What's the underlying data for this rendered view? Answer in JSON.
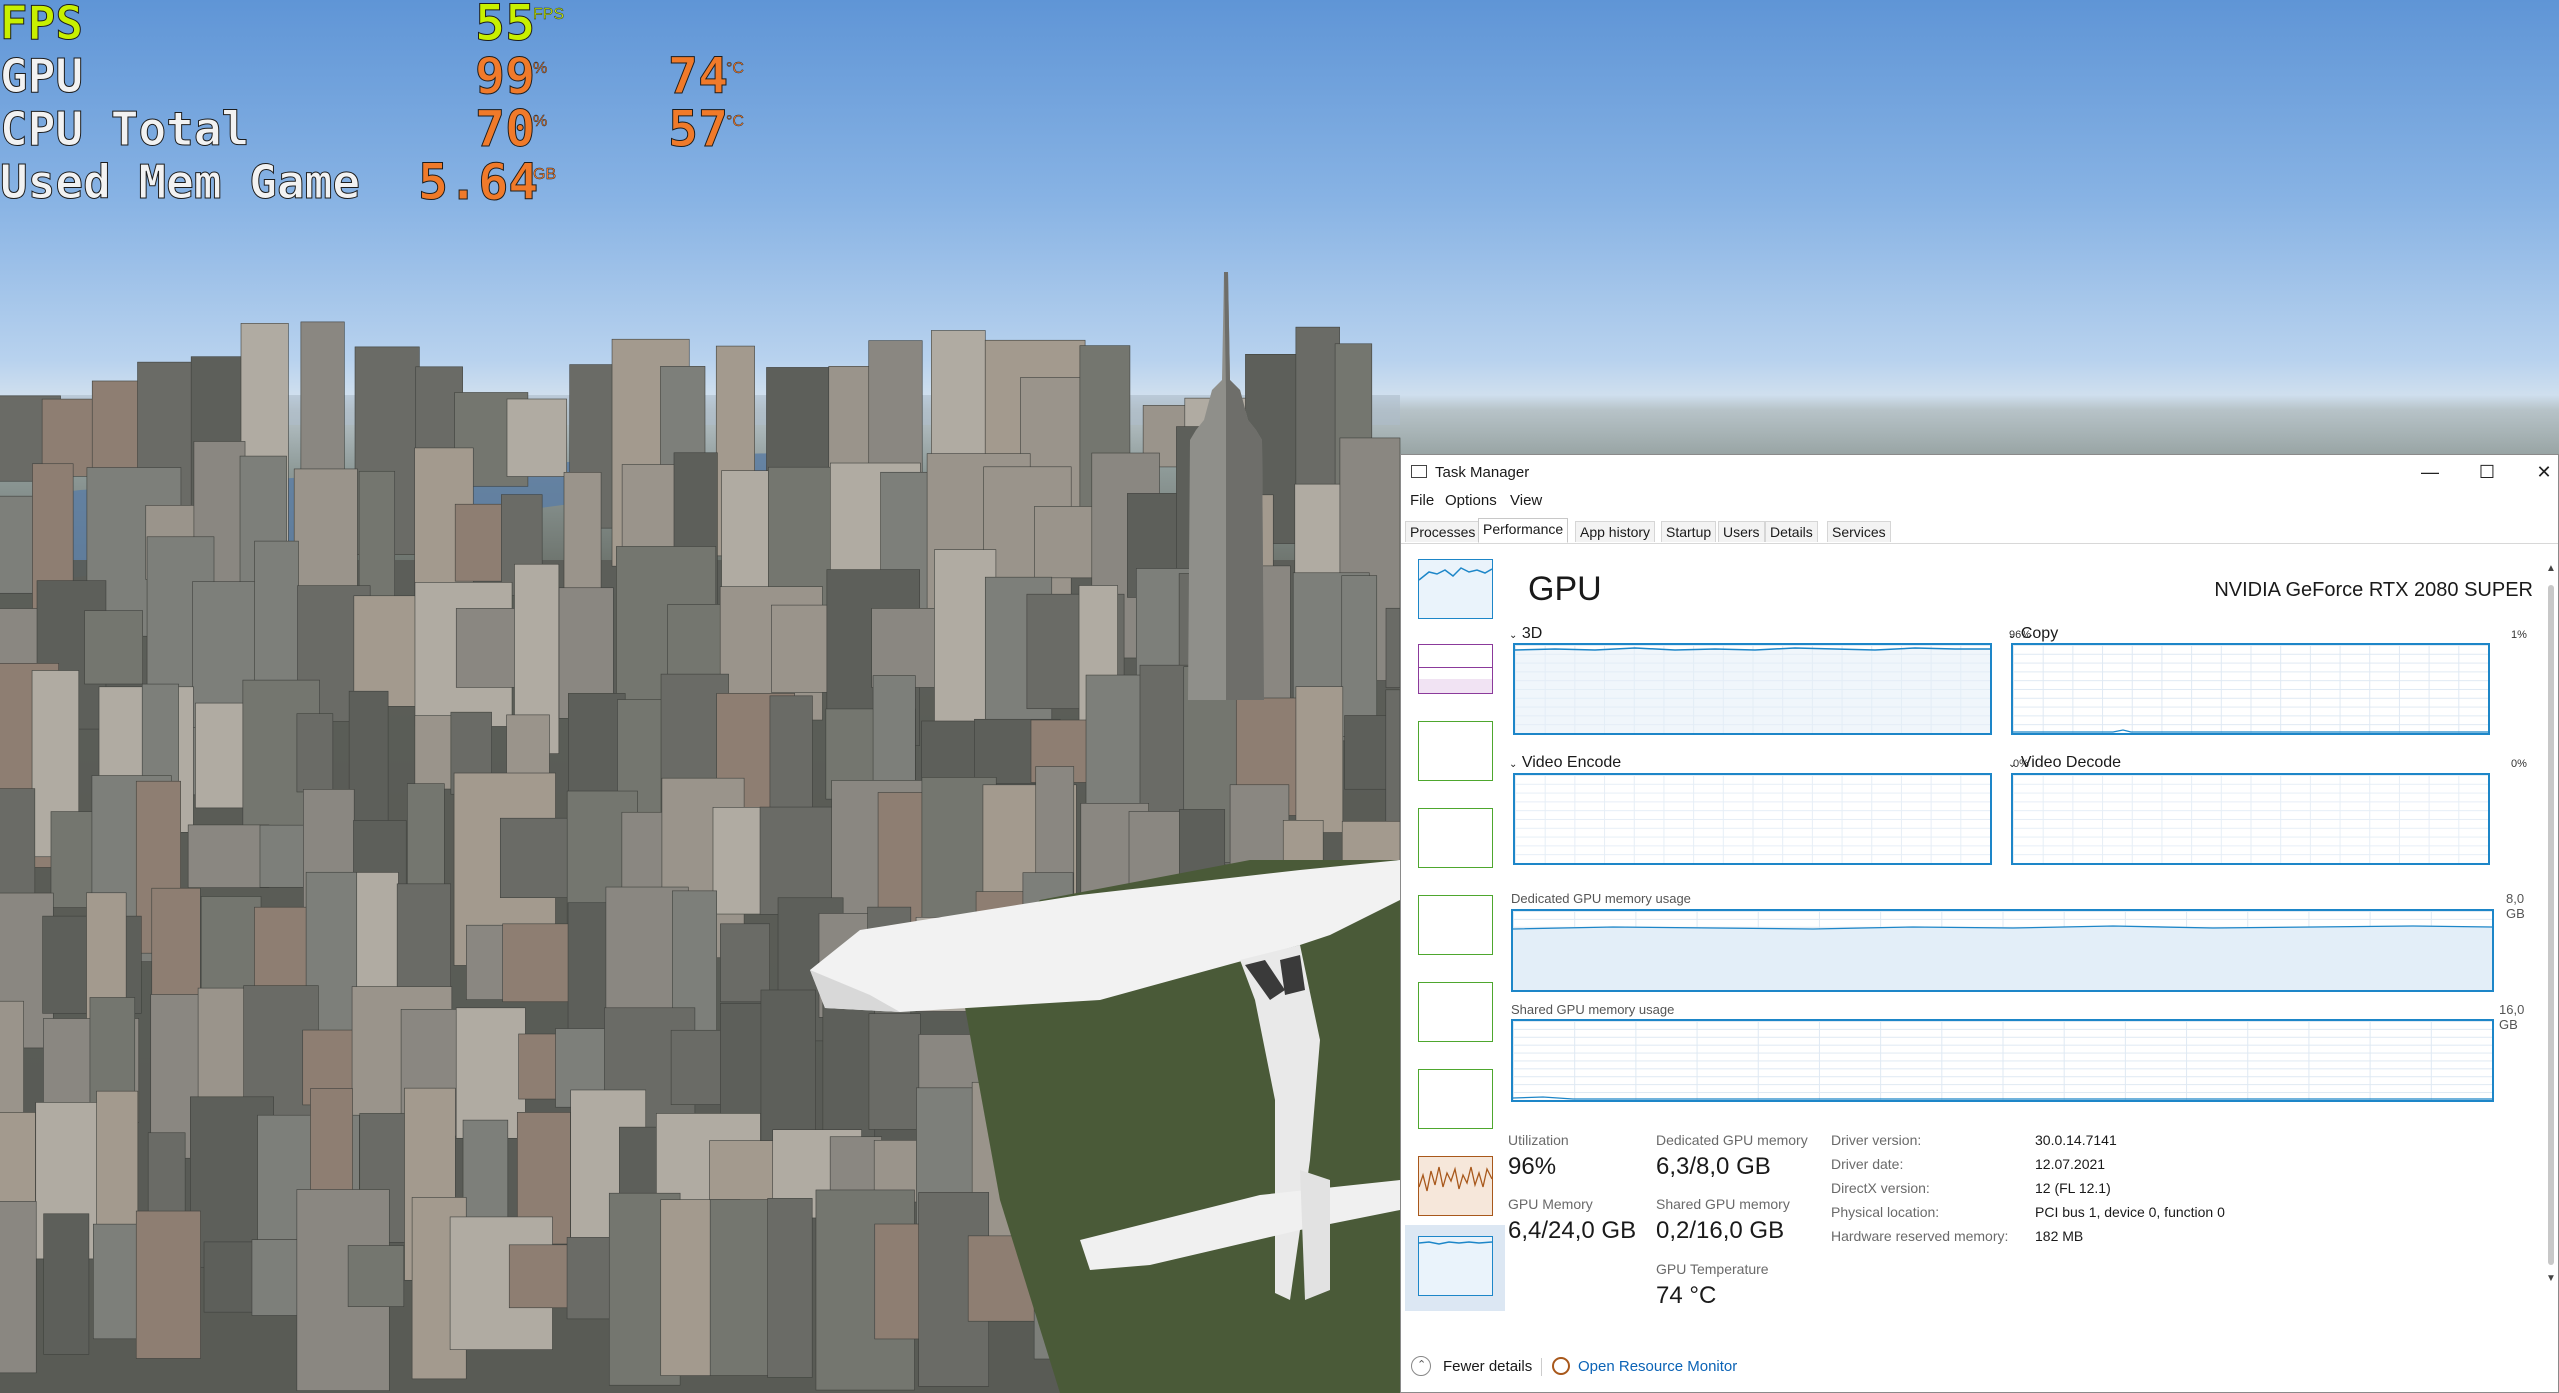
{
  "hud": {
    "fps": {
      "label": "FPS",
      "value": "55",
      "unit": "FPS"
    },
    "gpu": {
      "label": "GPU",
      "value": "99",
      "unit": "%",
      "temp": "74",
      "temp_unit": "°C"
    },
    "cpu": {
      "label": "CPU Total",
      "value": "70",
      "unit": "%",
      "temp": "57",
      "temp_unit": "°C"
    },
    "mem": {
      "label": "Used Mem Game",
      "value": "5.64",
      "unit": "GB"
    }
  },
  "task_manager": {
    "title": "Task Manager",
    "window_controls": {
      "minimize": "—",
      "maximize": "☐",
      "close": "✕"
    },
    "menu": [
      "File",
      "Options",
      "View"
    ],
    "tabs": [
      "Processes",
      "Performance",
      "App history",
      "Startup",
      "Users",
      "Details",
      "Services"
    ],
    "active_tab": "Performance",
    "gpu": {
      "heading": "GPU",
      "model": "NVIDIA GeForce RTX 2080 SUPER",
      "engines": [
        {
          "name": "3D",
          "percent": "96%",
          "level": 0.96
        },
        {
          "name": "Copy",
          "percent": "1%",
          "level": 0.01
        },
        {
          "name": "Video Encode",
          "percent": "0%",
          "level": 0.0
        },
        {
          "name": "Video Decode",
          "percent": "0%",
          "level": 0.0
        }
      ],
      "dedicated_graph": {
        "label": "Dedicated GPU memory usage",
        "max": "8,0 GB",
        "level": 0.79
      },
      "shared_graph": {
        "label": "Shared GPU memory usage",
        "max": "16,0 GB",
        "level": 0.0
      },
      "stats": {
        "utilization_label": "Utilization",
        "utilization": "96%",
        "gpu_memory_label": "GPU Memory",
        "gpu_memory": "6,4/24,0 GB",
        "dedicated_label": "Dedicated GPU memory",
        "dedicated": "6,3/8,0 GB",
        "shared_label": "Shared GPU memory",
        "shared": "0,2/16,0 GB",
        "temp_label": "GPU Temperature",
        "temp": "74 °C"
      },
      "info": [
        {
          "key": "Driver version:",
          "value": "30.0.14.7141"
        },
        {
          "key": "Driver date:",
          "value": "12.07.2021"
        },
        {
          "key": "DirectX version:",
          "value": "12 (FL 12.1)"
        },
        {
          "key": "Physical location:",
          "value": "PCI bus 1, device 0, function 0"
        },
        {
          "key": "Hardware reserved memory:",
          "value": "182 MB"
        }
      ]
    },
    "footer": {
      "fewer_details": "Fewer details",
      "resource_monitor": "Open Resource Monitor"
    },
    "colors": {
      "accent_blue": "#1d86c8",
      "cpu_green": "#4ea72e",
      "memory_purple": "#8b3a9b",
      "ethernet_orange": "#a8581b"
    }
  }
}
